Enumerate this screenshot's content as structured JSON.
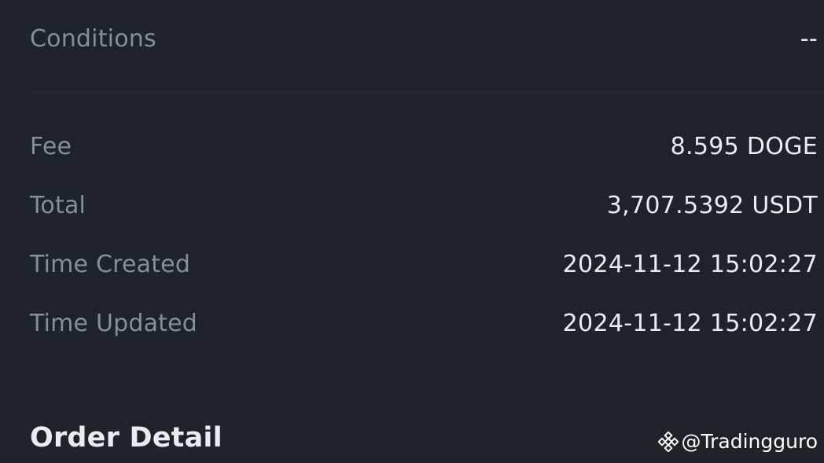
{
  "conditions": {
    "label": "Conditions",
    "value": "--"
  },
  "details": [
    {
      "label": "Fee",
      "value": "8.595 DOGE"
    },
    {
      "label": "Total",
      "value": "3,707.5392 USDT"
    },
    {
      "label": "Time Created",
      "value": "2024-11-12 15:02:27"
    },
    {
      "label": "Time Updated",
      "value": "2024-11-12 15:02:27"
    }
  ],
  "section_title": "Order Detail",
  "watermark": {
    "icon": "binance-logo-icon",
    "text": "@Tradingguro"
  }
}
